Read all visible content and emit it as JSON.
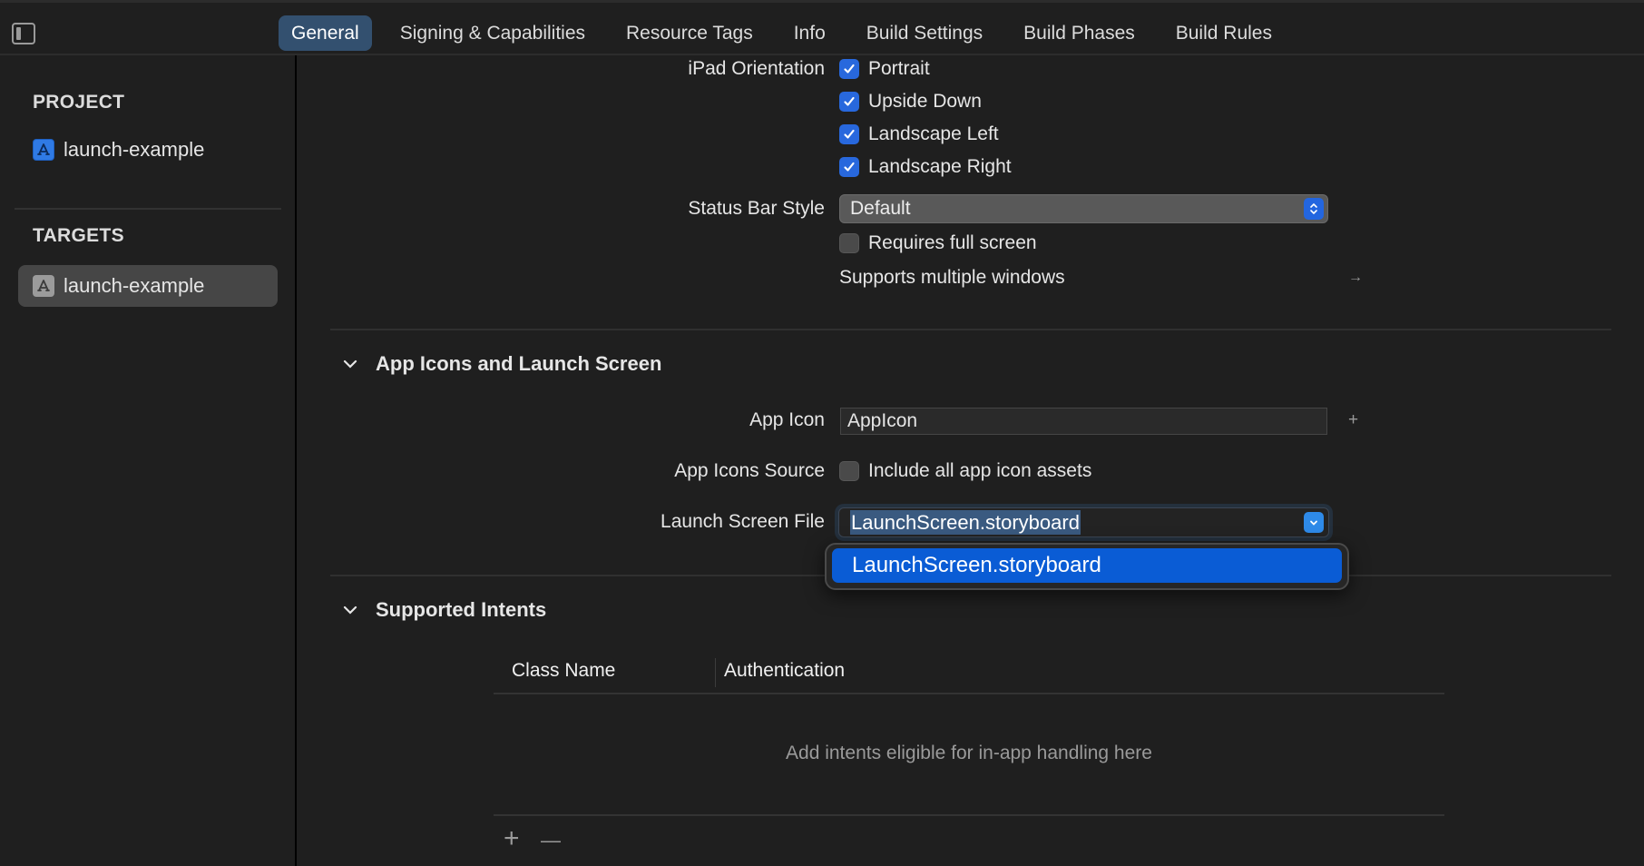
{
  "topbar": {
    "sidebar_toggle_icon": "sidebar-toggle-icon",
    "tabs": [
      {
        "label": "General",
        "active": true
      },
      {
        "label": "Signing & Capabilities",
        "active": false
      },
      {
        "label": "Resource Tags",
        "active": false
      },
      {
        "label": "Info",
        "active": false
      },
      {
        "label": "Build Settings",
        "active": false
      },
      {
        "label": "Build Phases",
        "active": false
      },
      {
        "label": "Build Rules",
        "active": false
      }
    ]
  },
  "sidebar": {
    "project_heading": "PROJECT",
    "project_item": {
      "label": "launch-example",
      "icon": "app-store-icon"
    },
    "targets_heading": "TARGETS",
    "target_item": {
      "label": "launch-example",
      "icon": "app-store-icon",
      "selected": true
    }
  },
  "deployment": {
    "ipad_orientation_label": "iPad Orientation",
    "orientations": [
      {
        "label": "Portrait",
        "checked": true
      },
      {
        "label": "Upside Down",
        "checked": true
      },
      {
        "label": "Landscape Left",
        "checked": true
      },
      {
        "label": "Landscape Right",
        "checked": true
      }
    ],
    "status_bar_style_label": "Status Bar Style",
    "status_bar_style_value": "Default",
    "requires_full_screen": {
      "label": "Requires full screen",
      "checked": false
    },
    "supports_multiple_windows": "Supports multiple windows",
    "arrow_icon": "arrow-right-icon"
  },
  "app_icons_section": {
    "title": "App Icons and Launch Screen",
    "app_icon_label": "App Icon",
    "app_icon_value": "AppIcon",
    "add_icon": "plus-icon",
    "app_icons_source_label": "App Icons Source",
    "include_all": {
      "label": "Include all app icon assets",
      "checked": false
    },
    "launch_screen_label": "Launch Screen File",
    "launch_screen_value": "LaunchScreen.storyboard",
    "dropdown_options": [
      "LaunchScreen.storyboard"
    ]
  },
  "intents_section": {
    "title": "Supported Intents",
    "columns": [
      "Class Name",
      "Authentication"
    ],
    "placeholder": "Add intents eligible for in-app handling here",
    "add_label": "+",
    "remove_label": "—"
  },
  "colors": {
    "accent": "#2868dd",
    "selected_tab": "#33506f",
    "menu_highlight": "#0a5cd5",
    "background": "#1f1f1f"
  }
}
